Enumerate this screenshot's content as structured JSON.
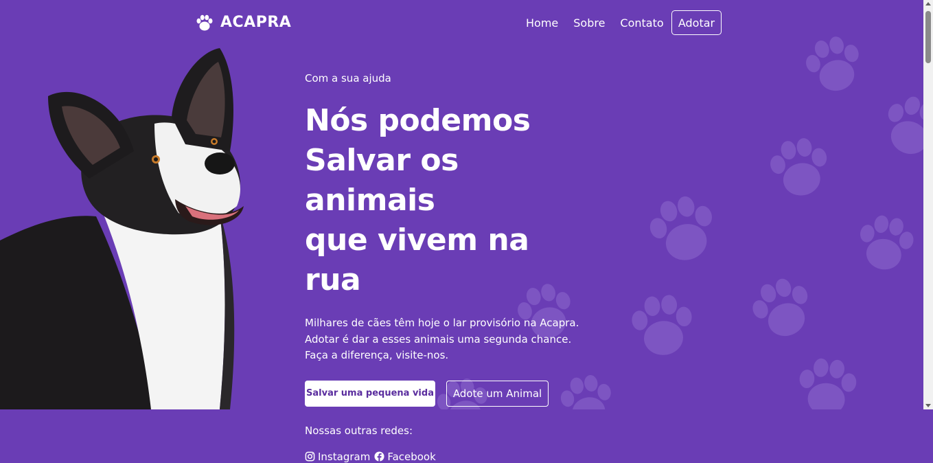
{
  "brand": {
    "name": "ACAPRA",
    "icon": "paw-icon"
  },
  "nav": {
    "links": [
      "Home",
      "Sobre",
      "Contato"
    ],
    "cta": "Adotar"
  },
  "hero": {
    "eyebrow": "Com a sua ajuda",
    "headline": [
      "Nós podemos",
      "Salvar os animais",
      "que vivem na rua"
    ],
    "description": "Milhares de cães têm hoje o lar provisório na Acapra. Adotar é dar a esses animais uma segunda chance. Faça a diferença, visite-nos.",
    "primary_button": "Salvar uma pequena vida",
    "secondary_button": "Adote um Animal",
    "social_title": "Nossas outras redes:",
    "socials": [
      {
        "label": "Instagram",
        "icon": "instagram-icon"
      },
      {
        "label": "Facebook",
        "icon": "facebook-icon"
      }
    ]
  },
  "colors": {
    "background": "#6a3db5",
    "paw": "#7d55c2",
    "text": "#ffffff"
  }
}
